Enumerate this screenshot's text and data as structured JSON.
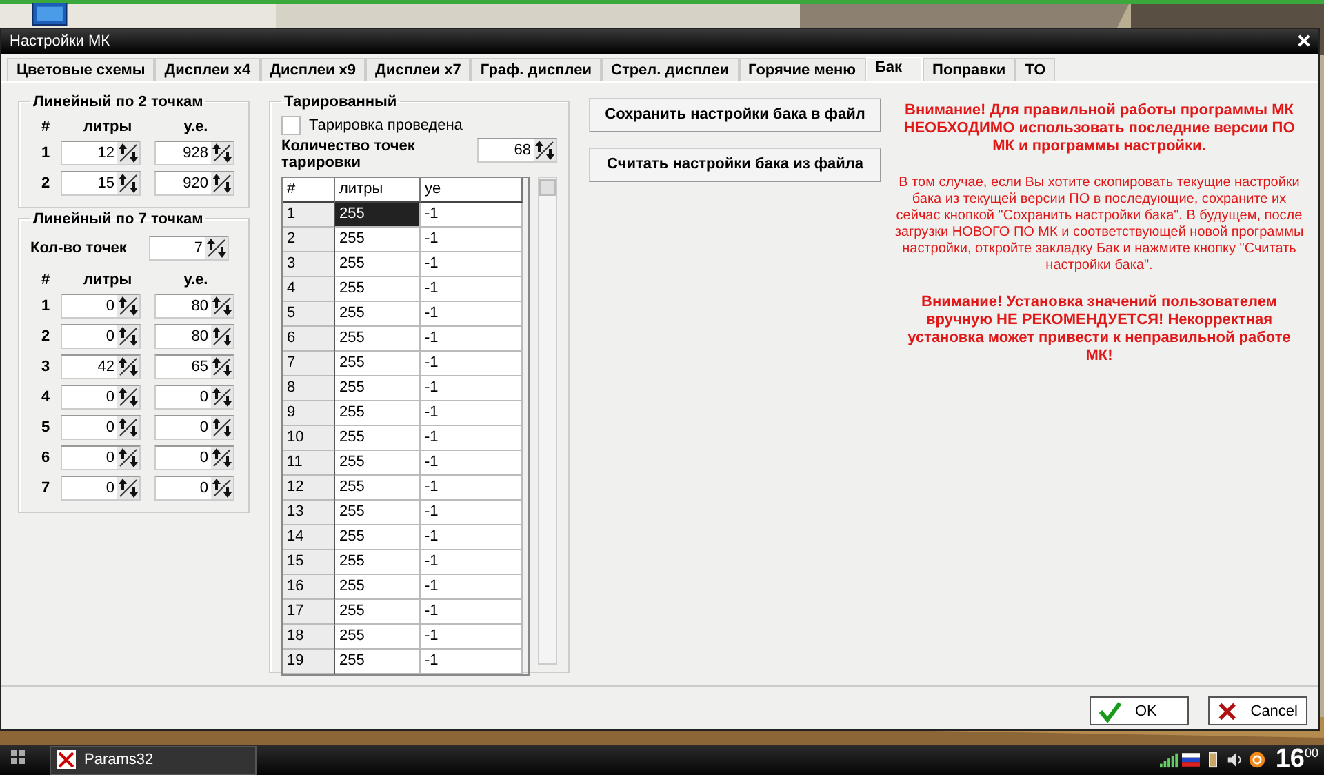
{
  "window": {
    "title": "Настройки МК"
  },
  "tabs": [
    {
      "label": "Цветовые схемы",
      "selected": false
    },
    {
      "label": "Дисплеи x4",
      "selected": false
    },
    {
      "label": "Дисплеи x9",
      "selected": false
    },
    {
      "label": "Дисплеи x7",
      "selected": false
    },
    {
      "label": "Граф. дисплеи",
      "selected": false
    },
    {
      "label": "Стрел. дисплеи",
      "selected": false
    },
    {
      "label": "Горячие меню",
      "selected": false
    },
    {
      "label": "Бак",
      "selected": true
    },
    {
      "label": "Поправки",
      "selected": false
    },
    {
      "label": "ТО",
      "selected": false
    }
  ],
  "linear_2": {
    "title": "Линейный по 2 точкам",
    "headers": [
      "#",
      "литры",
      "у.е."
    ],
    "rows": [
      {
        "index": "1",
        "liters": "12",
        "units": "928"
      },
      {
        "index": "2",
        "liters": "15",
        "units": "920"
      }
    ]
  },
  "linear_7": {
    "title": "Линейный по 7 точкам",
    "count_label": "Кол-во точек",
    "count": "7",
    "headers": [
      "#",
      "литры",
      "у.е."
    ],
    "rows": [
      {
        "index": "1",
        "liters": "0",
        "units": "80"
      },
      {
        "index": "2",
        "liters": "0",
        "units": "80"
      },
      {
        "index": "3",
        "liters": "42",
        "units": "65"
      },
      {
        "index": "4",
        "liters": "0",
        "units": "0"
      },
      {
        "index": "5",
        "liters": "0",
        "units": "0"
      },
      {
        "index": "6",
        "liters": "0",
        "units": "0"
      },
      {
        "index": "7",
        "liters": "0",
        "units": "0"
      }
    ]
  },
  "calibrated": {
    "title": "Тарированный",
    "checkbox": {
      "label": "Тарировка проведена",
      "checked": false
    },
    "points_label": "Количество точек тарировки",
    "points": "68",
    "table": {
      "columns": [
        "#",
        "литры",
        "ye"
      ],
      "rows": [
        {
          "index": "1",
          "liters": "255",
          "units": "-1",
          "selected": true
        },
        {
          "index": "2",
          "liters": "255",
          "units": "-1",
          "selected": false
        },
        {
          "index": "3",
          "liters": "255",
          "units": "-1",
          "selected": false
        },
        {
          "index": "4",
          "liters": "255",
          "units": "-1",
          "selected": false
        },
        {
          "index": "5",
          "liters": "255",
          "units": "-1",
          "selected": false
        },
        {
          "index": "6",
          "liters": "255",
          "units": "-1",
          "selected": false
        },
        {
          "index": "7",
          "liters": "255",
          "units": "-1",
          "selected": false
        },
        {
          "index": "8",
          "liters": "255",
          "units": "-1",
          "selected": false
        },
        {
          "index": "9",
          "liters": "255",
          "units": "-1",
          "selected": false
        },
        {
          "index": "10",
          "liters": "255",
          "units": "-1",
          "selected": false
        },
        {
          "index": "11",
          "liters": "255",
          "units": "-1",
          "selected": false
        },
        {
          "index": "12",
          "liters": "255",
          "units": "-1",
          "selected": false
        },
        {
          "index": "13",
          "liters": "255",
          "units": "-1",
          "selected": false
        },
        {
          "index": "14",
          "liters": "255",
          "units": "-1",
          "selected": false
        },
        {
          "index": "15",
          "liters": "255",
          "units": "-1",
          "selected": false
        },
        {
          "index": "16",
          "liters": "255",
          "units": "-1",
          "selected": false
        },
        {
          "index": "17",
          "liters": "255",
          "units": "-1",
          "selected": false
        },
        {
          "index": "18",
          "liters": "255",
          "units": "-1",
          "selected": false
        },
        {
          "index": "19",
          "liters": "255",
          "units": "-1",
          "selected": false
        }
      ]
    }
  },
  "file_buttons": [
    "Сохранить настройки бака в файл",
    "Считать настройки бака из файла"
  ],
  "notices": [
    {
      "kind": "bold",
      "text": "Внимание! Для правильной работы программы МК НЕОБХОДИМО использовать последние версии ПО МК и программы настройки."
    },
    {
      "kind": "plain",
      "text": "В том случае, если Вы хотите скопировать текущие настройки бака из текущей версии ПО в последующие, сохраните их сейчас кнопкой \"Сохранить настройки бака\". В будущем, после загрузки НОВОГО ПО МК и соответствующей новой программы настройки, откройте закладку Бак и нажмите кнопку \"Считать настройки бака\"."
    },
    {
      "kind": "bold",
      "text": "Внимание! Установка значений пользователем вручную НЕ РЕКОМЕНДУЕТСЯ! Некорректная установка может привести к неправильной работе МК!"
    }
  ],
  "dialog_buttons": [
    {
      "kind": "ok",
      "label": "OK"
    },
    {
      "kind": "cancel",
      "label": "Cancel"
    }
  ],
  "taskbar": {
    "task": "Params32",
    "clock_hour": "16",
    "clock_minute": "00"
  }
}
